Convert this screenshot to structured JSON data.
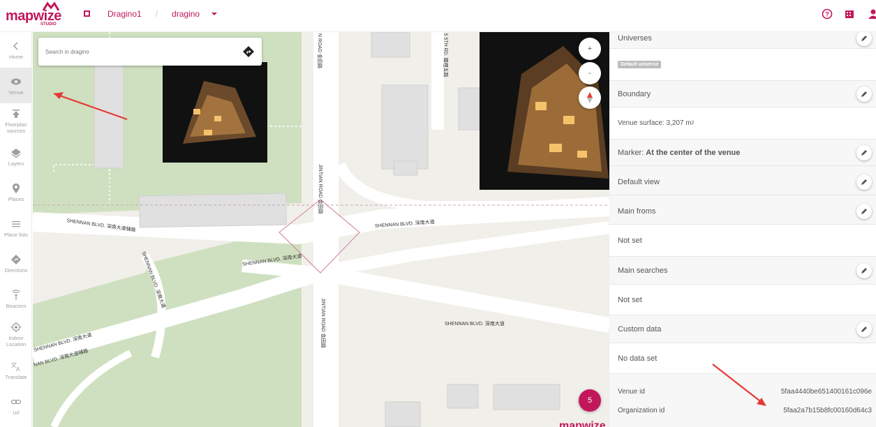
{
  "app": {
    "logo_text": "mapwize",
    "logo_sub": "STUDIO",
    "brand_color": "#c2185b"
  },
  "breadcrumb": {
    "organization": "Dragino1",
    "separator": "/",
    "venue": "dragino"
  },
  "sidebar": {
    "items": [
      {
        "label": "Home",
        "icon": "chevron-left-icon"
      },
      {
        "label": "Venue",
        "icon": "eye-icon",
        "active": true
      },
      {
        "label": "Floorplan sources",
        "icon": "upload-icon"
      },
      {
        "label": "Layers",
        "icon": "layers-icon"
      },
      {
        "label": "Places",
        "icon": "pin-icon"
      },
      {
        "label": "Place lists",
        "icon": "list-icon"
      },
      {
        "label": "Directions",
        "icon": "directions-icon"
      },
      {
        "label": "Beacons",
        "icon": "beacon-icon"
      },
      {
        "label": "Indoor Location",
        "icon": "target-icon"
      },
      {
        "label": "Translate",
        "icon": "translate-icon"
      },
      {
        "label": "Url",
        "icon": "link-icon"
      }
    ]
  },
  "map": {
    "search_placeholder": "Search in dragino",
    "zoom_in": "+",
    "zoom_out": "-",
    "fab_count": "5",
    "map_logo": "mapwize",
    "road_labels": {
      "shennan_fu": "SHENNAN BLVD. 深南大道辅路",
      "shennan_1": "SHENNAN BLVD. 深南大道",
      "shennan_2": "SHENNAN BLVD. 深南大道",
      "shennan_3": "SHENNAN BLVD. 深南大道",
      "shennan_4": "SHENNAN BLVD. 深南大道",
      "shennan_fu2": "NAN BLVD. 深南大道辅路",
      "shennan_v": "SHENNAN BLVD. 深南大道",
      "jintian_1": "JINTIAN ROAD 金田路",
      "jintian_2": "JINTIAN ROAD 金田路",
      "jintian_top": "N ROAD 金田路",
      "fifth_rd": "5 5TH RD. 國裡五路"
    }
  },
  "panel": {
    "universes_title": "Universes",
    "universes_badge": "Default universe",
    "boundary_title": "Boundary",
    "venue_surface_label": "Venue surface: 3,207 m",
    "venue_surface_sup": "2",
    "marker_label": "Marker: ",
    "marker_value": "At the center of the venue",
    "default_view": "Default view",
    "main_froms": "Main froms",
    "main_froms_value": "Not set",
    "main_searches": "Main searches",
    "main_searches_value": "Not set",
    "custom_data": "Custom data",
    "custom_data_value": "No data set",
    "venue_id_label": "Venue id",
    "venue_id": "5faa4440be651400161c096e",
    "org_id_label": "Organization id",
    "org_id": "5faa2a7b15b8fc00160d64c3"
  },
  "colors": {
    "accent": "#c2185b",
    "arrow": "#e53935",
    "park": "#cfe0c0",
    "road": "#ffffff"
  }
}
